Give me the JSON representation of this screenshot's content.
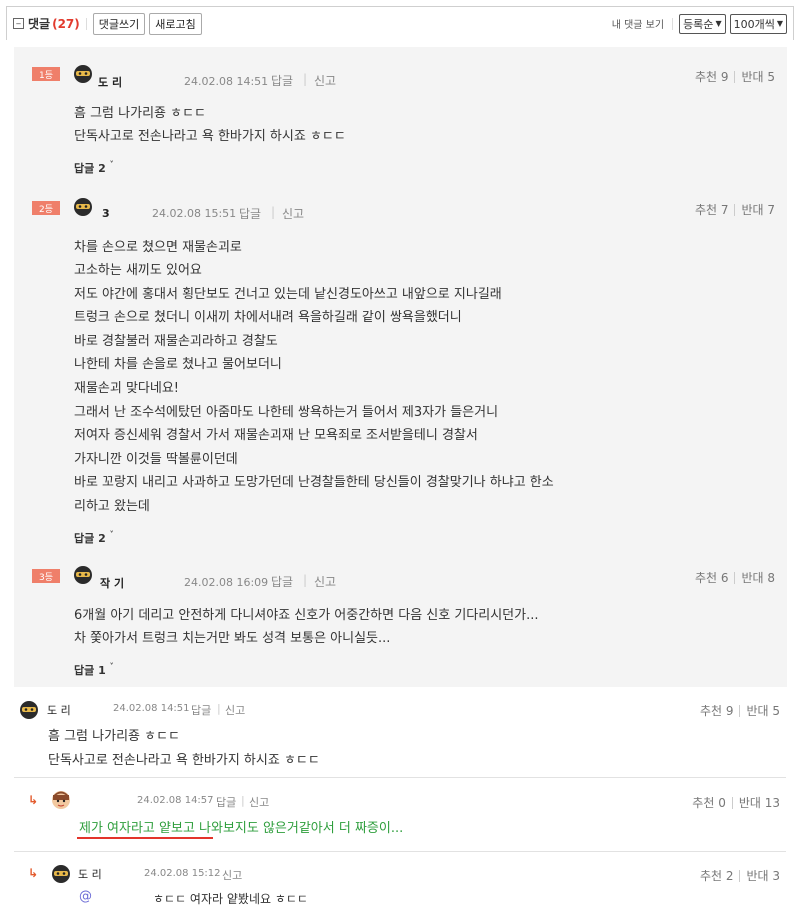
{
  "header": {
    "toggle_icon": "minus-square-icon",
    "title": "댓글",
    "count": "(27)",
    "write_label": "댓글쓰기",
    "refresh_label": "새로고침",
    "my_comments_label": "내 댓글 보기",
    "sort_value": "등록순",
    "page_size_value": "100개씩"
  },
  "best": [
    {
      "rank": "1등",
      "nick": "도 리",
      "date": "24.02.08 14:51",
      "reply_action": "답글",
      "report_action": "신고",
      "up_label": "추천 9",
      "down_label": "반대 5",
      "lines": [
        "흠 그럼 나가리죵 ㅎㄷㄷ",
        "단독사고로 전손나라고 욕 한바가지 하시죠 ㅎㄷㄷ"
      ],
      "replies_label": "답글 2"
    },
    {
      "rank": "2등",
      "nick": "3",
      "date": "24.02.08 15:51",
      "reply_action": "답글",
      "report_action": "신고",
      "up_label": "추천 7",
      "down_label": "반대 7",
      "lines": [
        "차를 손으로 쳤으면 재물손괴로",
        "고소하는 새끼도 있어요",
        "저도 야간에 홍대서 횡단보도 건너고 있는데 낱신경도아쓰고 내앞으로 지나길래",
        "트렁크 손으로 쳤더니 이새끼 차에서내려 욕을하길래 같이 쌍욕을했더니",
        "바로 경찰불러 재물손괴라하고 경찰도",
        "나한테 차를 손을로 쳤나고 물어보더니",
        "재물손괴 맞다네요!",
        "그래서 난 조수석에탔던 아줌마도 나한테 쌍욕하는거 들어서 제3자가 들은거니",
        "저여자 증신세워 경찰서 가서 재물손괴재 난 모욕죄로 조서받을테니 경찰서",
        "가자니깐 이것들 딱볼륜이던데",
        "바로 꼬랑지 내리고 사과하고 도망가던데 난경찰들한테 당신들이 경찰맞기나 하냐고 한소",
        "리하고 왔는데"
      ],
      "replies_label": "답글 2"
    },
    {
      "rank": "3등",
      "nick": "작 기",
      "date": "24.02.08 16:09",
      "reply_action": "답글",
      "report_action": "신고",
      "up_label": "추천 6",
      "down_label": "반대 8",
      "lines": [
        "6개월 아기 데리고 안전하게 다니셔야죠 신호가 어중간하면 다음 신호 기다리시던가...",
        "차 쫓아가서 트렁크 치는거만 봐도 성격 보통은 아니실듯..."
      ],
      "replies_label": "답글 1"
    }
  ],
  "comments": [
    {
      "nick": "도 리",
      "date": "24.02.08 14:51",
      "reply_action": "답글",
      "report_action": "신고",
      "up_label": "추천 9",
      "down_label": "반대 5",
      "lines": [
        "흠 그럼 나가리죵 ㅎㄷㄷ",
        "단독사고로 전손나라고 욕 한바가지 하시죠 ㅎㄷㄷ"
      ]
    },
    {
      "is_reply": true,
      "nick": "",
      "date": "24.02.08 14:57",
      "reply_action": "답글",
      "report_action": "신고",
      "up_label": "추천 0",
      "down_label": "반대 13",
      "lines": [
        "제가 여자라고 얕보고 나와보지도 않은거같아서 더 짜증이..."
      ]
    },
    {
      "is_reply": true,
      "nick": "도 리",
      "date": "24.02.08 15:12",
      "report_action": "신고",
      "up_label": "추천 2",
      "down_label": "반대 3",
      "mention": "@",
      "lines": [
        "ㅎㄷㄷ 여자라 얕봤네요 ㅎㄷㄷ"
      ]
    }
  ],
  "colors": {
    "rank_badge": "#ef7f6a",
    "comment_count": "#e23b2e",
    "highlight_text": "#2e9e3c",
    "underline": "#e3342b",
    "reply_arrow": "#e35b2e"
  }
}
